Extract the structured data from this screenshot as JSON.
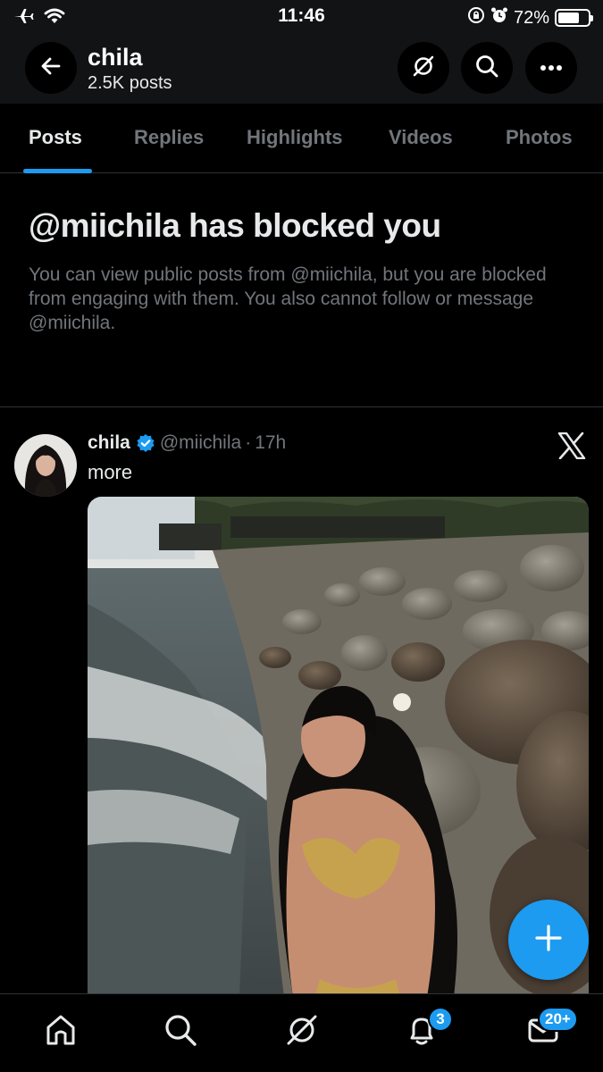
{
  "status_bar": {
    "time": "11:46",
    "battery_text": "72%",
    "battery_level": 0.72,
    "icons": [
      "airplane-icon",
      "wifi-icon",
      "orientation-lock-icon",
      "alarm-icon",
      "battery-icon"
    ]
  },
  "header": {
    "name": "chila",
    "posts_count": "2.5K posts",
    "icons": [
      "back-arrow-icon",
      "grok-icon",
      "search-icon",
      "more-icon"
    ]
  },
  "tabs": [
    "Posts",
    "Replies",
    "Highlights",
    "Videos",
    "Photos"
  ],
  "active_tab": "Posts",
  "blocked_notice": {
    "title": "@miichila has blocked you",
    "body": "You can view public posts from @miichila, but you are blocked from engaging with them. You also cannot follow or message @miichila."
  },
  "post": {
    "name": "chila",
    "handle": "@miichila",
    "separator": "·",
    "time": "17h",
    "text": "more",
    "verified": true
  },
  "bottom_nav": {
    "items": [
      "home-icon",
      "search-icon",
      "grok-icon",
      "notifications-icon",
      "messages-icon"
    ],
    "notifications_badge": "3",
    "messages_badge": "20+"
  },
  "colors": {
    "accent": "#1d9bf0",
    "background": "#000000",
    "header_bg": "#121314",
    "muted_text": "#71767b",
    "text": "#e7e9ea"
  }
}
